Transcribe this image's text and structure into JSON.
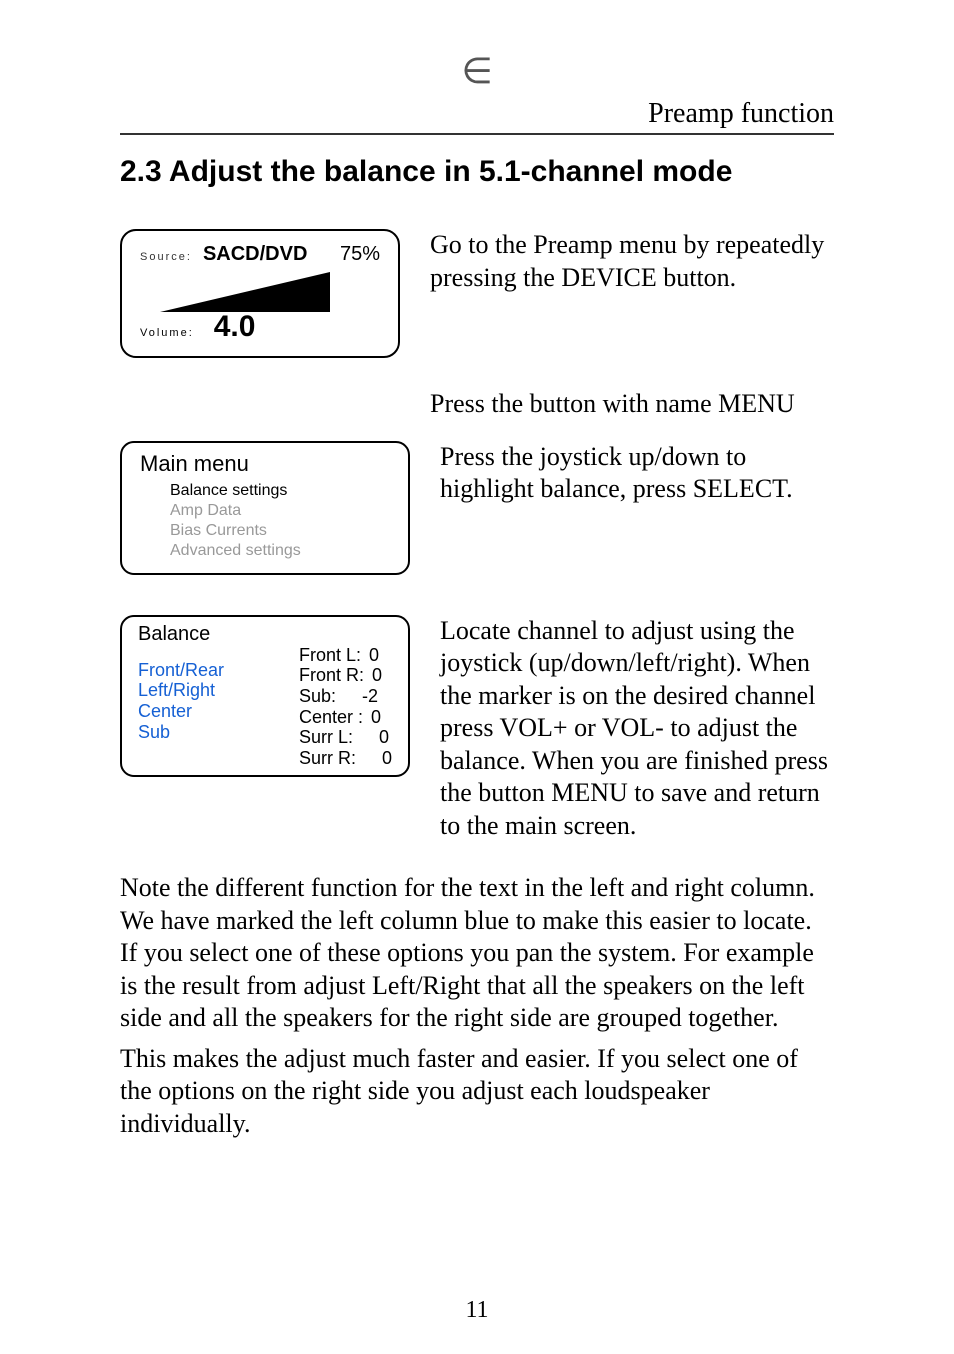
{
  "top_glyph": "∈",
  "header": "Preamp function",
  "heading": "2.3 Adjust the balance in 5.1-channel mode",
  "lcd1": {
    "source_label": "Source:",
    "source_value": "SACD/DVD",
    "percent": "75%",
    "volume_label": "Volume:",
    "volume_value": "4.0"
  },
  "para1": "Go to the Preamp menu by repeatedly pressing the DEVICE button.",
  "para2": "Press the button with name MENU",
  "para3": "Press the joystick up/down to highlight balance,  press SELECT.",
  "main_menu": {
    "title": "Main menu",
    "items": [
      "Balance settings",
      "Amp Data",
      "Bias Currents",
      "Advanced settings"
    ]
  },
  "balance": {
    "title": "Balance",
    "left_options": [
      "Front/Rear",
      "Left/Right",
      "Center",
      "Sub"
    ],
    "right": [
      {
        "label": "Front L:",
        "val": "0"
      },
      {
        "label": "Front R:",
        "val": "0"
      },
      {
        "label": "Sub:",
        "val": "-2"
      },
      {
        "label": "Center :",
        "val": "0"
      },
      {
        "label": "Surr L:",
        "val": "0"
      },
      {
        "label": "Surr R:",
        "val": "0"
      }
    ]
  },
  "para4": "Locate channel to adjust using the joystick (up/down/left/right). When the marker is on the desired channel press VOL+ or VOL- to adjust the balance. When you are finished press  the button MENU to save and return to the main screen.",
  "para5": "Note the different function for the text in the left and right column. We have marked the left column blue to make this easier to locate.  If you select one of these options you pan the system. For example is the result from adjust Left/Right that all the speakers on the left side and all the speakers for the right side are grouped together.",
  "para6": "This makes the adjust much faster and easier.  If you select one of the options on the right side you adjust each loudspeaker individually.",
  "page_number": "11"
}
